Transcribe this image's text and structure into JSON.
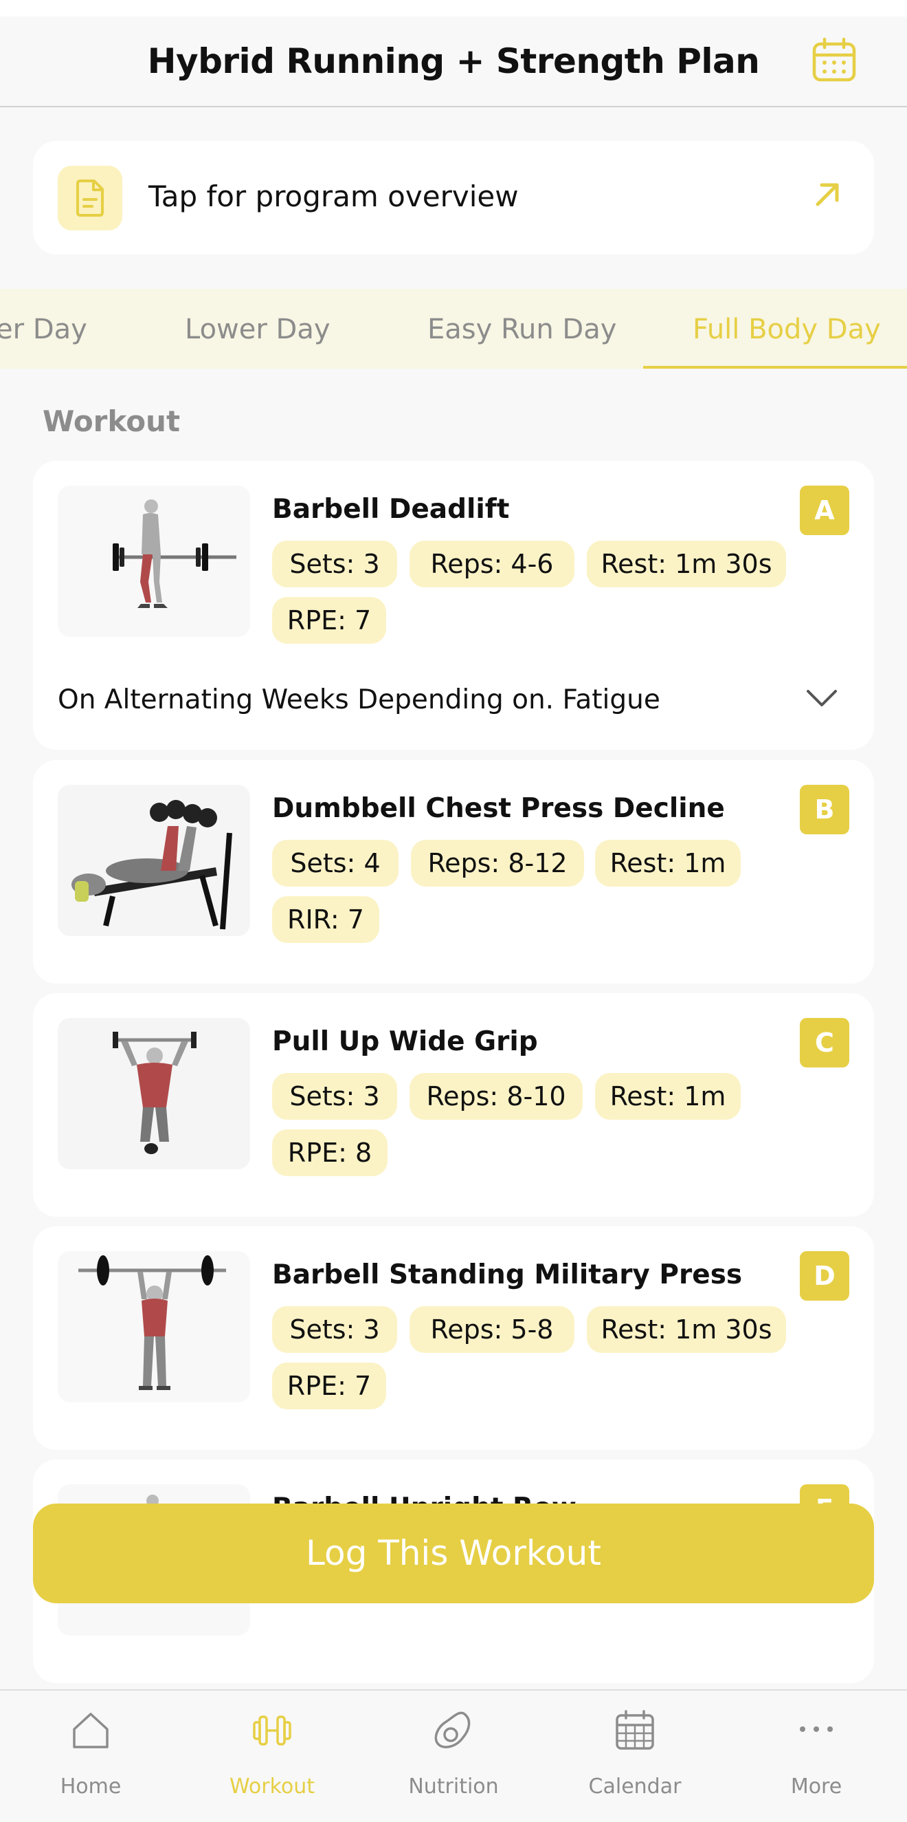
{
  "header": {
    "title": "Hybrid Running + Strength Plan",
    "calendar_icon": "calendar-icon"
  },
  "overview": {
    "label": "Tap for program overview",
    "icon": "document-icon",
    "action_icon": "arrow-up-right-icon"
  },
  "tabs": [
    {
      "label": "Upper Day",
      "active": false
    },
    {
      "label": "Lower Day",
      "active": false
    },
    {
      "label": "Easy Run Day",
      "active": false
    },
    {
      "label": "Full Body Day",
      "active": true
    }
  ],
  "section_label": "Workout",
  "exercises": [
    {
      "letter": "A",
      "name": "Barbell Deadlift",
      "chips": [
        "Sets: 3",
        "Reps: 4-6",
        "Rest: 1m 30s",
        "RPE: 7"
      ],
      "note": "On Alternating Weeks Depending on. Fatigue"
    },
    {
      "letter": "B",
      "name": "Dumbbell Chest Press Decline",
      "chips": [
        "Sets: 4",
        "Reps: 8-12",
        "Rest: 1m",
        "RIR: 7"
      ]
    },
    {
      "letter": "C",
      "name": "Pull Up Wide Grip",
      "chips": [
        "Sets: 3",
        "Reps: 8-10",
        "Rest: 1m",
        "RPE: 8"
      ]
    },
    {
      "letter": "D",
      "name": "Barbell Standing Military Press",
      "chips": [
        "Sets: 3",
        "Reps: 5-8",
        "Rest: 1m 30s",
        "RPE: 7"
      ]
    },
    {
      "letter": "E",
      "name": "Barbell Upright Row"
    }
  ],
  "log_button": "Log This Workout",
  "tabbar": [
    {
      "label": "Home",
      "icon": "home-icon",
      "active": false
    },
    {
      "label": "Workout",
      "icon": "dumbbell-icon",
      "active": true
    },
    {
      "label": "Nutrition",
      "icon": "avocado-icon",
      "active": false
    },
    {
      "label": "Calendar",
      "icon": "calendar-icon",
      "active": false
    },
    {
      "label": "More",
      "icon": "more-icon",
      "active": false
    }
  ],
  "colors": {
    "accent": "#e6cf45",
    "chip_bg": "#fbf3c6",
    "muted_text": "#8c8c8c",
    "background": "#f8f8f8",
    "card": "#ffffff"
  }
}
